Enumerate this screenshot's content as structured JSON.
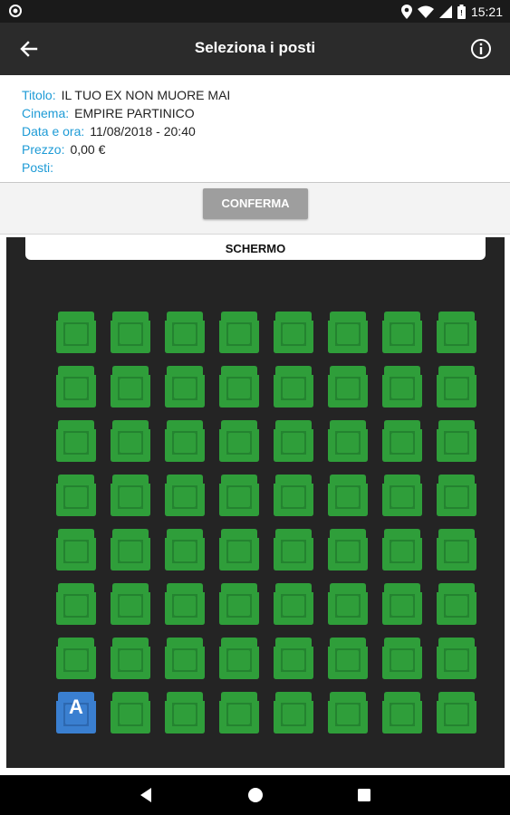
{
  "status_bar": {
    "time": "15:21",
    "icons": [
      "notification-dot-icon",
      "location-icon",
      "wifi-icon",
      "signal-icon",
      "battery-icon"
    ]
  },
  "toolbar": {
    "title": "Seleziona i posti",
    "back_icon": "back-arrow-icon",
    "info_icon": "info-icon"
  },
  "details": {
    "title_label": "Titolo:",
    "title_value": "IL TUO EX NON MUORE MAI",
    "cinema_label": "Cinema:",
    "cinema_value": "EMPIRE PARTINICO",
    "datetime_label": "Data e ora:",
    "datetime_value": "11/08/2018 - 20:40",
    "price_label": "Prezzo:",
    "price_value": "0,00 €",
    "seats_label": "Posti:",
    "seats_value": ""
  },
  "confirm_label": "CONFERMA",
  "screen_label": "SCHERMO",
  "colors": {
    "accent": "#1e9bd6",
    "seat_available": "#2f9e3a",
    "seat_special": "#3a7fd0",
    "hall_bg": "#242424"
  },
  "seating": {
    "rows": 8,
    "cols": 8,
    "special": [
      {
        "row": 8,
        "col": 1,
        "letter": "A"
      }
    ]
  },
  "nav_icons": [
    "nav-back-icon",
    "nav-home-icon",
    "nav-recents-icon"
  ]
}
